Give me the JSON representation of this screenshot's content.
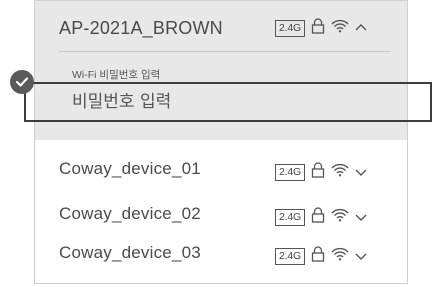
{
  "selected_network": {
    "ssid": "AP-2021A_BROWN",
    "band": "2.4G",
    "secured": true,
    "expanded": true,
    "password_label": "Wi-Fi 비밀번호 입력",
    "password_placeholder": "비밀번호 입력"
  },
  "networks": [
    {
      "ssid": "Coway_device_01",
      "band": "2.4G",
      "secured": true
    },
    {
      "ssid": "Coway_device_02",
      "band": "2.4G",
      "secured": true
    },
    {
      "ssid": "Coway_device_03",
      "band": "2.4G",
      "secured": true
    }
  ],
  "icons": {
    "lock": "lock-icon",
    "wifi": "wifi-icon",
    "expand": "chevron-down-icon",
    "collapse": "chevron-up-icon",
    "check": "check-circle-icon"
  }
}
